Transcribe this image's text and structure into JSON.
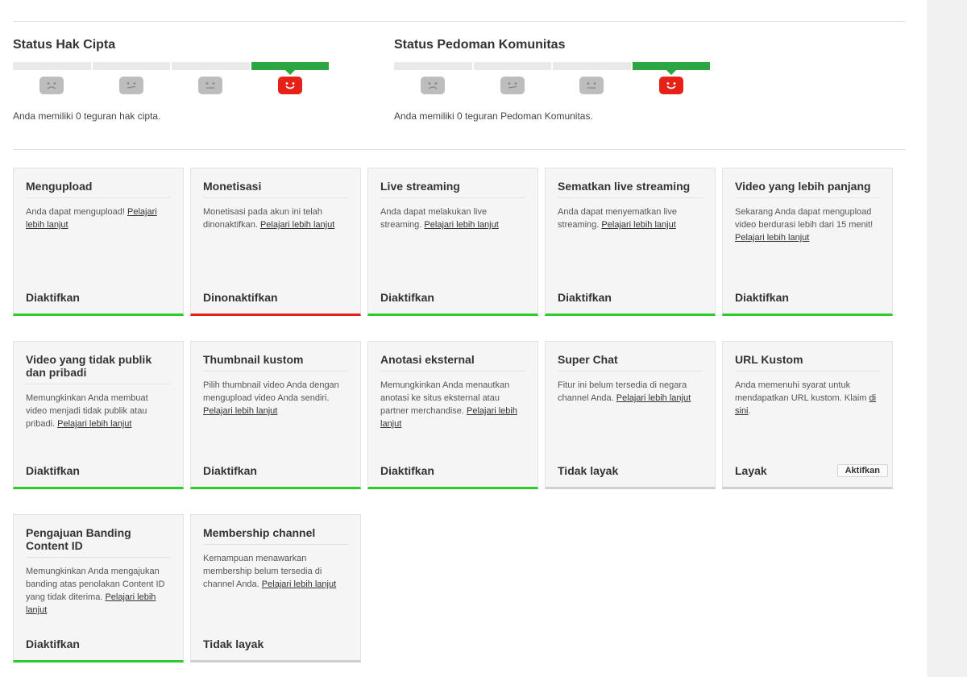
{
  "copyright": {
    "title": "Status Hak Cipta",
    "text": "Anda memiliki 0 teguran hak cipta.",
    "faces": [
      "sad-face-icon",
      "unsure-face-icon",
      "neutral-face-icon",
      "happy-face-icon"
    ],
    "active_index": 3
  },
  "community": {
    "title": "Status Pedoman Komunitas",
    "text": "Anda memiliki 0 teguran Pedoman Komunitas.",
    "faces": [
      "sad-face-icon",
      "unsure-face-icon",
      "neutral-face-icon",
      "happy-face-icon"
    ],
    "active_index": 3
  },
  "colors": {
    "active": "#2ba640",
    "enabled": "#2bcb2b",
    "disabled": "#e62117",
    "ineligible": "#cfcfcf",
    "face_active": "#e62117",
    "face_inactive": "#bdbdbd"
  },
  "cards": [
    {
      "title": "Mengupload",
      "desc": "Anda dapat mengupload! ",
      "link": "Pelajari lebih lanjut",
      "desc_after": "",
      "status": "Diaktifkan",
      "state": "ok"
    },
    {
      "title": "Monetisasi",
      "desc": "Monetisasi pada akun ini telah dinonaktifkan. ",
      "link": "Pelajari lebih lanjut",
      "desc_after": "",
      "status": "Dinonaktifkan",
      "state": "off"
    },
    {
      "title": "Live streaming",
      "desc": "Anda dapat melakukan live streaming. ",
      "link": "Pelajari lebih lanjut",
      "desc_after": "",
      "status": "Diaktifkan",
      "state": "ok"
    },
    {
      "title": "Sematkan live streaming",
      "desc": "Anda dapat menyematkan live streaming. ",
      "link": "Pelajari lebih lanjut",
      "desc_after": "",
      "status": "Diaktifkan",
      "state": "ok"
    },
    {
      "title": "Video yang lebih panjang",
      "desc": "Sekarang Anda dapat mengupload video berdurasi lebih dari 15 menit! ",
      "link": "Pelajari lebih lanjut",
      "desc_after": "",
      "status": "Diaktifkan",
      "state": "ok"
    },
    {
      "title": "Video yang tidak publik dan pribadi",
      "desc": "Memungkinkan Anda membuat video menjadi tidak publik atau pribadi. ",
      "link": "Pelajari lebih lanjut",
      "desc_after": "",
      "status": "Diaktifkan",
      "state": "ok"
    },
    {
      "title": "Thumbnail kustom",
      "desc": "Pilih thumbnail video Anda dengan mengupload video Anda sendiri. ",
      "link": "Pelajari lebih lanjut",
      "desc_after": "",
      "status": "Diaktifkan",
      "state": "ok"
    },
    {
      "title": "Anotasi eksternal",
      "desc": "Memungkinkan Anda menautkan anotasi ke situs eksternal atau partner merchandise. ",
      "link": "Pelajari lebih lanjut",
      "desc_after": "",
      "status": "Diaktifkan",
      "state": "ok"
    },
    {
      "title": "Super Chat",
      "desc": "Fitur ini belum tersedia di negara channel Anda. ",
      "link": "Pelajari lebih lanjut",
      "desc_after": "",
      "status": "Tidak layak",
      "state": "na"
    },
    {
      "title": "URL Kustom",
      "desc": "Anda memenuhi syarat untuk mendapatkan URL kustom. Klaim ",
      "link": "di sini",
      "desc_after": ".",
      "status": "Layak",
      "state": "na",
      "button": "Aktifkan"
    },
    {
      "title": "Pengajuan Banding Content ID",
      "desc": "Memungkinkan Anda mengajukan banding atas penolakan Content ID yang tidak diterima. ",
      "link": "Pelajari lebih lanjut",
      "desc_after": "",
      "status": "Diaktifkan",
      "state": "ok"
    },
    {
      "title": "Membership channel",
      "desc": "Kemampuan menawarkan membership belum tersedia di channel Anda. ",
      "link": "Pelajari lebih lanjut",
      "desc_after": "",
      "status": "Tidak layak",
      "state": "na"
    }
  ]
}
